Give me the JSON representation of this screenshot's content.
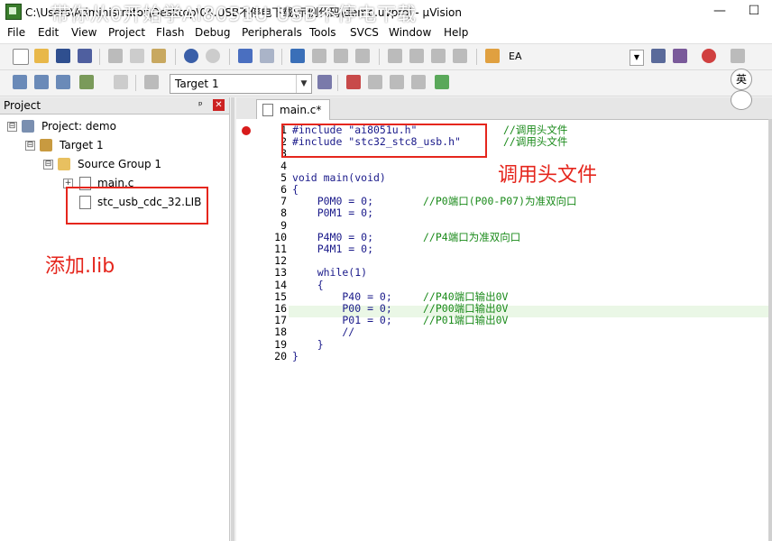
{
  "window": {
    "title": "C:\\Users\\Administrator\\Desktop\\04.USB不停电下载\\示例代码\\demo.uvproj - µVision",
    "overlay_title": "带你从0开始学Ai8051U USB不停电下载",
    "minimize": "—",
    "maximize": "☐"
  },
  "menu": [
    "File",
    "Edit",
    "View",
    "Project",
    "Flash",
    "Debug",
    "Peripherals",
    "Tools",
    "SVCS",
    "Window",
    "Help"
  ],
  "toolbar2": {
    "target_label": "Target 1",
    "ea_label": "EA"
  },
  "project_panel": {
    "title": "Project",
    "pin": "ᵖ",
    "close": "✕",
    "tree": [
      {
        "label": "Project: demo",
        "expander": "⊟"
      },
      {
        "label": "Target 1",
        "expander": "⊟"
      },
      {
        "label": "Source Group 1",
        "expander": "⊟"
      },
      {
        "label": "main.c",
        "expander": "+"
      },
      {
        "label": "stc_usb_cdc_32.LIB",
        "expander": ""
      }
    ]
  },
  "editor": {
    "tab_label": "main.c*",
    "lines": [
      {
        "n": "1",
        "text": "#include \"ai8051u.h\"",
        "comment": "//调用头文件"
      },
      {
        "n": "2",
        "text": "#include \"stc32_stc8_usb.h\"",
        "comment": "//调用头文件"
      },
      {
        "n": "3",
        "text": "",
        "comment": ""
      },
      {
        "n": "4",
        "text": "",
        "comment": ""
      },
      {
        "n": "5",
        "text": "void main(void)",
        "comment": ""
      },
      {
        "n": "6",
        "text": "{",
        "comment": ""
      },
      {
        "n": "7",
        "text": "    P0M0 = 0;",
        "comment": "//P0端口(P00-P07)为准双向口"
      },
      {
        "n": "8",
        "text": "    P0M1 = 0;",
        "comment": ""
      },
      {
        "n": "9",
        "text": "",
        "comment": ""
      },
      {
        "n": "10",
        "text": "    P4M0 = 0;",
        "comment": "//P4端口为准双向口"
      },
      {
        "n": "11",
        "text": "    P4M1 = 0;",
        "comment": ""
      },
      {
        "n": "12",
        "text": "",
        "comment": ""
      },
      {
        "n": "13",
        "text": "    while(1)",
        "comment": ""
      },
      {
        "n": "14",
        "text": "    {",
        "comment": ""
      },
      {
        "n": "15",
        "text": "        P40 = 0;",
        "comment": "//P40端口输出0V"
      },
      {
        "n": "16",
        "text": "        P00 = 0;",
        "comment": "//P00端口输出0V"
      },
      {
        "n": "17",
        "text": "        P01 = 0;",
        "comment": "//P01端口输出0V"
      },
      {
        "n": "18",
        "text": "        //",
        "comment": ""
      },
      {
        "n": "19",
        "text": "    }",
        "comment": ""
      },
      {
        "n": "20",
        "text": "}",
        "comment": ""
      }
    ]
  },
  "annotations": {
    "header_note": "调用头文件",
    "lib_note": "添加.lib"
  },
  "deco": {
    "badge": "英"
  },
  "colors": {
    "annotation_red": "#e5261d",
    "breakpoint_red": "#d81b1b",
    "current_line_bg": "#eaf7e6"
  }
}
